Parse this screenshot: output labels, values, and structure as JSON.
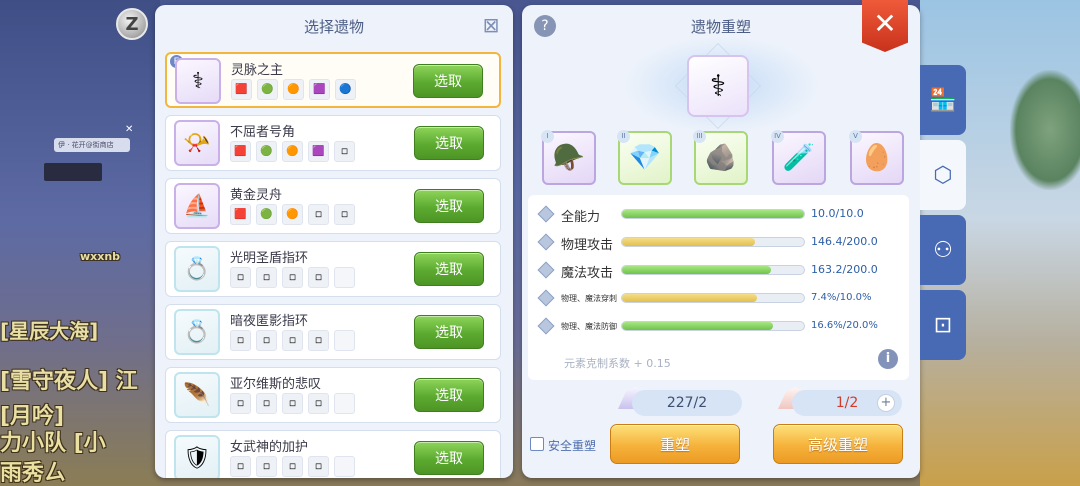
{
  "top_icon": {
    "letter": "Z"
  },
  "background": {
    "nameplate": "伊 · 花开@街商店",
    "chat_fragments": [
      "wxxnb",
      "[星辰大海]",
      "[雪守夜人] 江",
      "[月吟]",
      "力小队 [小",
      "雨秀ㄙ"
    ]
  },
  "relic_select": {
    "title": "选择遗物",
    "close_icon": "close-icon",
    "selected_badge": "E",
    "pick_label": "选取",
    "items": [
      {
        "name": "灵脉之主",
        "icon": "⚕",
        "selected": true,
        "muted": false,
        "slots": [
          "🟥",
          "🟢",
          "🟠",
          "🟪",
          "🔵"
        ]
      },
      {
        "name": "不屈者号角",
        "icon": "📯",
        "selected": false,
        "muted": false,
        "slots": [
          "🟥",
          "🟢",
          "🟠",
          "🟪",
          "◽"
        ]
      },
      {
        "name": "黄金灵舟",
        "icon": "⛵",
        "selected": false,
        "muted": false,
        "slots": [
          "🟥",
          "🟢",
          "🟠",
          "◽",
          "◽"
        ]
      },
      {
        "name": "光明圣盾指环",
        "icon": "💍",
        "selected": false,
        "muted": true,
        "slots": [
          "◽",
          "◽",
          "◽",
          "◽",
          ""
        ]
      },
      {
        "name": "暗夜匿影指环",
        "icon": "💍",
        "selected": false,
        "muted": true,
        "slots": [
          "◽",
          "◽",
          "◽",
          "◽",
          ""
        ]
      },
      {
        "name": "亚尔维斯的悲叹",
        "icon": "🪶",
        "selected": false,
        "muted": true,
        "slots": [
          "◽",
          "◽",
          "◽",
          "◽",
          ""
        ]
      },
      {
        "name": "女武神的加护",
        "icon": "🛡",
        "selected": false,
        "muted": true,
        "slots": [
          "◽",
          "◽",
          "◽",
          "◽",
          ""
        ]
      }
    ]
  },
  "reforge": {
    "title": "遗物重塑",
    "help_icon": "?",
    "close_icon": "✕",
    "main_relic_icon": "⚕",
    "materials": [
      {
        "roman": "I",
        "icon": "🪖",
        "style": "purple"
      },
      {
        "roman": "II",
        "icon": "💎",
        "style": "green"
      },
      {
        "roman": "III",
        "icon": "🪨",
        "style": "green"
      },
      {
        "roman": "IV",
        "icon": "🧪",
        "style": "purple"
      },
      {
        "roman": "V",
        "icon": "🥚",
        "style": "purple"
      }
    ],
    "stats": [
      {
        "label": "全能力",
        "value": "10.0/10.0",
        "fill": 1.0,
        "color": "green",
        "size": "big"
      },
      {
        "label": "物理攻击",
        "value": "146.4/200.0",
        "fill": 0.732,
        "color": "yellow",
        "size": "big"
      },
      {
        "label": "魔法攻击",
        "value": "163.2/200.0",
        "fill": 0.816,
        "color": "green",
        "size": "big"
      },
      {
        "label": "物理、魔法穿刺",
        "value": "7.4%/10.0%",
        "fill": 0.74,
        "color": "yellow",
        "size": "small"
      },
      {
        "label": "物理、魔法防御",
        "value": "16.6%/20.0%",
        "fill": 0.83,
        "color": "green",
        "size": "small"
      }
    ],
    "element_coefficient": "元素克制系数 + 0.15",
    "info_icon": "i",
    "cost_normal": "227/2",
    "cost_advanced": "1/2",
    "plus_label": "+",
    "safe_reforge_label": "安全重塑",
    "reforge_button": "重塑",
    "advanced_reforge_button": "高级重塑"
  },
  "side_tabs": [
    {
      "name": "shop-tab",
      "icon": "🏪",
      "active": false
    },
    {
      "name": "relic-tab",
      "icon": "⬡",
      "active": true
    },
    {
      "name": "nodes-tab",
      "icon": "⚇",
      "active": false
    },
    {
      "name": "frame-tab",
      "icon": "⊡",
      "active": false
    }
  ]
}
